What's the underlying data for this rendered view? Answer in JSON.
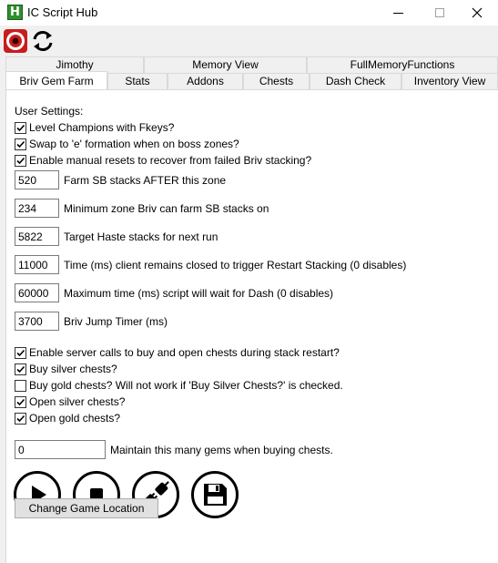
{
  "window": {
    "title": "IC Script Hub",
    "app_icon_letter": "H",
    "app_icon_color": "#2f8f2f"
  },
  "toolbar": {
    "icons": [
      "eye-icon",
      "reload-icon"
    ]
  },
  "tabs": {
    "row1": [
      "Jimothy",
      "Memory View",
      "FullMemoryFunctions"
    ],
    "row2": [
      "Briv Gem Farm",
      "Stats",
      "Addons",
      "Chests",
      "Dash Check",
      "Inventory View"
    ],
    "active": "Briv Gem Farm"
  },
  "settings": {
    "section_label": "User Settings:",
    "checkboxes_top": [
      {
        "label": "Level Champions with Fkeys?",
        "checked": true
      },
      {
        "label": "Swap to 'e' formation when on boss zones?",
        "checked": true
      },
      {
        "label": "Enable manual resets to recover from failed Briv stacking?",
        "checked": true
      }
    ],
    "numeric_fields": [
      {
        "value": "520",
        "label": "Farm SB stacks AFTER this zone"
      },
      {
        "value": "234",
        "label": "Minimum zone Briv can farm SB stacks on"
      },
      {
        "value": "5822",
        "label": "Target Haste stacks for next run"
      },
      {
        "value": "11000",
        "label": "Time (ms) client remains closed to trigger Restart Stacking (0 disables)"
      },
      {
        "value": "60000",
        "label": "Maximum time (ms) script will wait for Dash (0 disables)"
      },
      {
        "value": "3700",
        "label": "Briv Jump Timer (ms)"
      }
    ],
    "checkboxes_chests": [
      {
        "label": "Enable server calls to buy and open chests during stack restart?",
        "checked": true
      },
      {
        "label": "Buy silver chests?",
        "checked": true
      },
      {
        "label": "Buy gold chests? Will not work if 'Buy Silver Chests?' is checked.",
        "checked": false
      },
      {
        "label": "Open silver chests?",
        "checked": true
      },
      {
        "label": "Open gold chests?",
        "checked": true
      }
    ],
    "gems_field": {
      "value": "0",
      "label": "Maintain this many gems when buying chests."
    }
  },
  "controls": {
    "buttons": [
      "play-icon",
      "stop-icon",
      "connect-icon",
      "save-icon"
    ],
    "change_location_label": "Change Game Location"
  }
}
